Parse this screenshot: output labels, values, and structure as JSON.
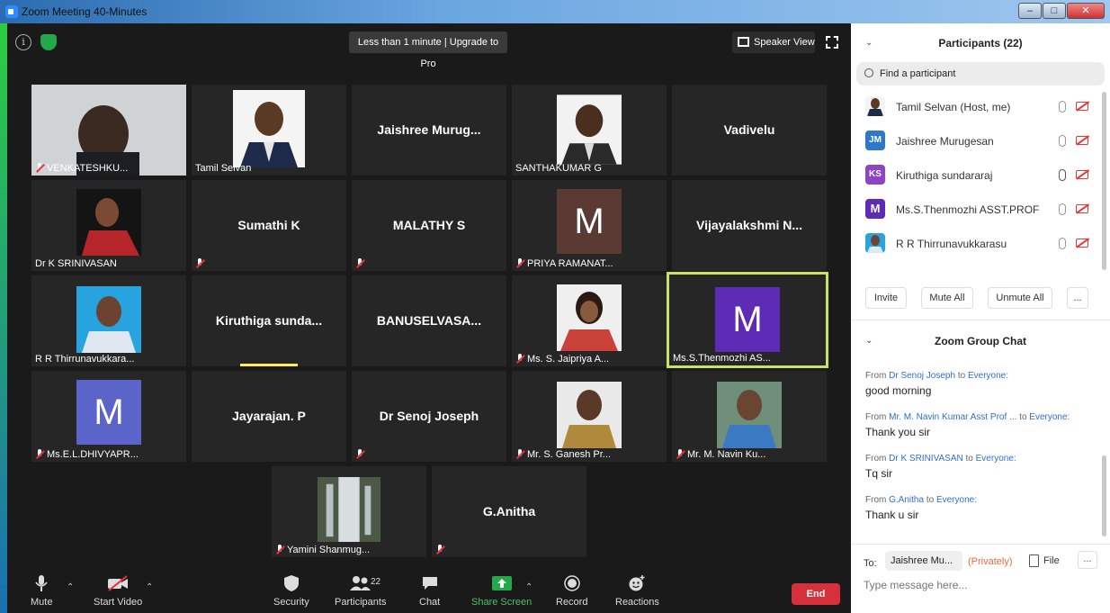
{
  "window": {
    "title": "Zoom Meeting 40-Minutes"
  },
  "meeting": {
    "banner": "Less than 1 minute | Upgrade to Pro",
    "speaker_view": "Speaker View"
  },
  "tiles": {
    "t1": "VENKATESHKU...",
    "t2": "Tamil Selvan",
    "t3": "Jaishree  Murug...",
    "t4": "SANTHAKUMAR G",
    "t5": "Vadivelu",
    "t6": "Dr K SRINIVASAN",
    "t7": "Sumathi K",
    "t8": "MALATHY S",
    "t9": "PRIYA RAMANAT...",
    "t9_letter": "M",
    "t10": "Vijayalakshmi  N...",
    "t11": "R R Thirrunavukkara...",
    "t12": "Kiruthiga  sunda...",
    "t13": "BANUSELVASA...",
    "t14": "Ms. S. Jaipriya A...",
    "t15": "Ms.S.Thenmozhi AS...",
    "t15_letter": "M",
    "t16": "Ms.E.L.DHIVYAPR...",
    "t16_letter": "M",
    "t17": "Jayarajan. P",
    "t18": "Dr Senoj Joseph",
    "t19": "Mr. S. Ganesh Pr...",
    "t20": "Mr. M. Navin Ku...",
    "t21": "Yamini Shanmug...",
    "t22": "G.Anitha"
  },
  "toolbar": {
    "mute": "Mute",
    "start_video": "Start Video",
    "security": "Security",
    "participants": "Participants",
    "participants_count": "22",
    "chat": "Chat",
    "share_screen": "Share Screen",
    "record": "Record",
    "reactions": "Reactions",
    "end": "End"
  },
  "participants": {
    "title": "Participants (22)",
    "search_placeholder": "Find a participant",
    "list": [
      {
        "name": "Tamil Selvan (Host, me)",
        "avatar": ""
      },
      {
        "name": "Jaishree Murugesan",
        "avatar": "JM"
      },
      {
        "name": "Kiruthiga sundararaj",
        "avatar": "KS"
      },
      {
        "name": "Ms.S.Thenmozhi ASST.PROF",
        "avatar": "M"
      },
      {
        "name": "R R Thirrunavukkarasu",
        "avatar": ""
      }
    ],
    "invite": "Invite",
    "mute_all": "Mute All",
    "unmute_all": "Unmute All",
    "more": "..."
  },
  "chat": {
    "title": "Zoom Group Chat",
    "messages": [
      {
        "from_prefix": "From",
        "from": "Dr Senoj Joseph",
        "to_prefix": "to",
        "to": "Everyone:",
        "text": "good morning"
      },
      {
        "from_prefix": "From",
        "from": "Mr. M. Navin Kumar Asst Prof ...",
        "to_prefix": "to",
        "to": "Everyone:",
        "text": "Thank you sir"
      },
      {
        "from_prefix": "From",
        "from": "Dr K SRINIVASAN",
        "to_prefix": "to",
        "to": "Everyone:",
        "text": "Tq sir"
      },
      {
        "from_prefix": "From",
        "from": "G.Anitha",
        "to_prefix": "to",
        "to": "Everyone:",
        "text": "Thank u sir"
      }
    ],
    "to_label": "To:",
    "to_value": "Jaishree Mu...",
    "privately": "(Privately)",
    "file": "File",
    "more": "...",
    "input_placeholder": "Type message here..."
  },
  "colors": {
    "accent": "#2d8cff",
    "active_speaker": "#c9e265",
    "end": "#d6313a",
    "share": "#23a94a",
    "muted": "#e33333"
  }
}
